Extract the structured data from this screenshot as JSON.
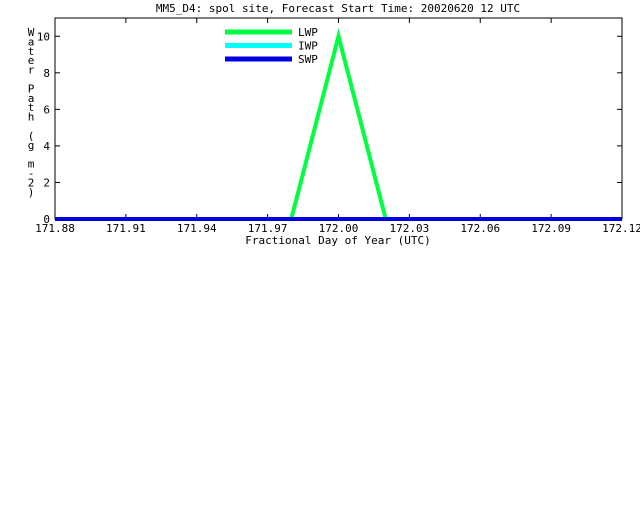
{
  "chart_data": {
    "type": "line",
    "title": "MM5_D4: spol site,  Forecast Start Time: 20020620 12 UTC",
    "xlabel": "Fractional Day of Year (UTC)",
    "ylabel": "Water Path (g m-2)",
    "ylabel_chars": [
      "W",
      "a",
      "t",
      "e",
      "r",
      "",
      "P",
      "a",
      "t",
      "h",
      "",
      "(",
      "g",
      "",
      "m",
      "-",
      "2",
      ")"
    ],
    "xlim": [
      171.88,
      172.12
    ],
    "ylim": [
      0,
      11
    ],
    "x_ticks": [
      "171.88",
      "171.91",
      "171.94",
      "171.97",
      "172.00",
      "172.03",
      "172.06",
      "172.09",
      "172.12"
    ],
    "y_ticks": [
      "0",
      "2",
      "4",
      "6",
      "8",
      "10"
    ],
    "series": [
      {
        "name": "LWP",
        "color": "#00ff40",
        "x": [
          171.88,
          171.98,
          172.0,
          172.02,
          172.12
        ],
        "y": [
          0,
          0,
          10,
          0,
          0
        ]
      },
      {
        "name": "IWP",
        "color": "#00ffff",
        "x": [
          171.88,
          172.12
        ],
        "y": [
          0,
          0
        ]
      },
      {
        "name": "SWP",
        "color": "#0000e0",
        "x": [
          171.88,
          172.12
        ],
        "y": [
          0,
          0
        ]
      }
    ],
    "legend_position": "top-center"
  }
}
